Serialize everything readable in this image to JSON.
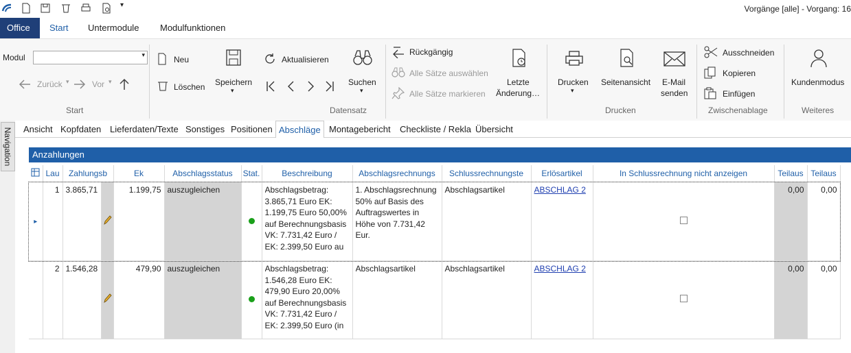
{
  "window": {
    "title": "Vorgänge [alle] - Vorgang: 16"
  },
  "menu": {
    "office": "Office",
    "start": "Start",
    "untermodule": "Untermodule",
    "modulfunktionen": "Modulfunktionen"
  },
  "ribbon": {
    "start": {
      "modul_label": "Modul",
      "modul_value": "",
      "back": "Zurück",
      "forward": "Vor",
      "group": "Start"
    },
    "datensatz": {
      "neu": "Neu",
      "loeschen": "Löschen",
      "speichern": "Speichern",
      "aktualisieren": "Aktualisieren",
      "suchen": "Suchen",
      "rueckgaengig": "Rückgängig",
      "alle_auswaehlen": "Alle Sätze auswählen",
      "alle_markieren": "Alle Sätze markieren",
      "letzte_line1": "Letzte",
      "letzte_line2": "Änderung…",
      "group": "Datensatz"
    },
    "drucken": {
      "drucken": "Drucken",
      "seitenansicht": "Seitenansicht",
      "email_line1": "E-Mail",
      "email_line2": "senden",
      "group": "Drucken"
    },
    "zwischenablage": {
      "ausschneiden": "Ausschneiden",
      "kopieren": "Kopieren",
      "einfuegen": "Einfügen",
      "group": "Zwischenablage"
    },
    "weiteres": {
      "kundenmodus": "Kundenmodus",
      "group": "Weiteres"
    }
  },
  "navigation": {
    "label": "Navigation"
  },
  "subtabs": [
    "Ansicht",
    "Kopfdaten",
    "Lieferdaten/Texte",
    "Sonstiges",
    "Positionen",
    "Abschläge",
    "Montagebericht",
    "Checkliste / Rekla",
    "Übersicht"
  ],
  "active_subtab": "Abschläge",
  "section": {
    "title": "Anzahlungen"
  },
  "table": {
    "columns": [
      "Lau",
      "Zahlungsb",
      "Ek",
      "Abschlagsstatus",
      "Stat.",
      "Beschreibung",
      "Abschlagsrechnungs",
      "Schlussrechnungste",
      "Erlösartikel",
      "In Schlussrechnung nicht anzeigen",
      "Teilaus",
      "Teilaus"
    ],
    "rows": [
      {
        "lau": "1",
        "zahlungsbetrag": "3.865,71",
        "ek": "1.199,75",
        "status": "auszugleichen",
        "beschreibung": "Abschlagsbetrag: 3.865,71 Euro EK: 1.199,75 Euro 50,00% auf Berechnungsbasis VK: 7.731,42 Euro / EK: 2.399,50 Euro au",
        "abschlagsrechnung": "1. Abschlagsrechnung 50% auf Basis des Auftragswertes in Höhe von 7.731,42 Eur.",
        "schlussrechnung": "Abschlagsartikel",
        "erloesartikel": "ABSCHLAG 2",
        "teil1": "0,00",
        "teil2": "0,00"
      },
      {
        "lau": "2",
        "zahlungsbetrag": "1.546,28",
        "ek": "479,90",
        "status": "auszugleichen",
        "beschreibung": "Abschlagsbetrag: 1.546,28 Euro EK: 479,90 Euro 20,00% auf Berechnungsbasis VK: 7.731,42 Euro / EK: 2.399,50 Euro (in",
        "abschlagsrechnung": "Abschlagsartikel",
        "schlussrechnung": "Abschlagsartikel",
        "erloesartikel": "ABSCHLAG 2",
        "teil1": "0,00",
        "teil2": "0,00"
      }
    ]
  },
  "colors": {
    "accent": "#1f5fa8",
    "office_tab": "#1f3f78",
    "status_ok": "#1aa01a"
  }
}
